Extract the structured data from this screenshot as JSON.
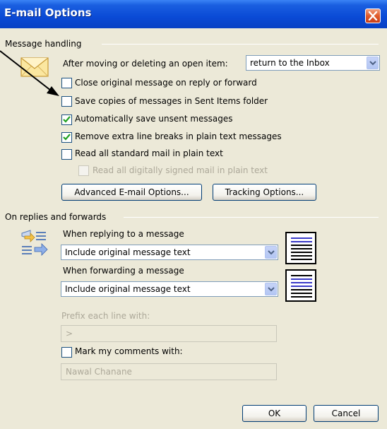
{
  "window": {
    "title": "E-mail Options"
  },
  "message_handling": {
    "group_label": "Message handling",
    "after_moving_label": "After moving or deleting an open item:",
    "after_moving_value": "return to the Inbox",
    "options": [
      {
        "label": "Close original message on reply or forward",
        "checked": false,
        "enabled": true
      },
      {
        "label": "Save copies of messages in Sent Items folder",
        "checked": false,
        "enabled": true
      },
      {
        "label": "Automatically save unsent messages",
        "checked": true,
        "enabled": true
      },
      {
        "label": "Remove extra line breaks in plain text messages",
        "checked": true,
        "enabled": true
      },
      {
        "label": "Read all standard mail in plain text",
        "checked": false,
        "enabled": true
      },
      {
        "label": "Read all digitally signed mail in plain text",
        "checked": false,
        "enabled": false
      }
    ],
    "advanced_button": "Advanced E-mail Options...",
    "tracking_button": "Tracking Options..."
  },
  "replies": {
    "group_label": "On replies and forwards",
    "replying_label": "When replying to a message",
    "replying_value": "Include original message text",
    "forwarding_label": "When forwarding a message",
    "forwarding_value": "Include original message text",
    "prefix_label": "Prefix each line with:",
    "prefix_value": ">",
    "mark_label": "Mark my comments with:",
    "mark_checked": false,
    "mark_value": "Nawal Chanane"
  },
  "footer": {
    "ok": "OK",
    "cancel": "Cancel"
  },
  "colors": {
    "titlebar": "#0a4ad6",
    "dialog_bg": "#ece9d8",
    "check": "#21a121",
    "disabled": "#aca899"
  }
}
